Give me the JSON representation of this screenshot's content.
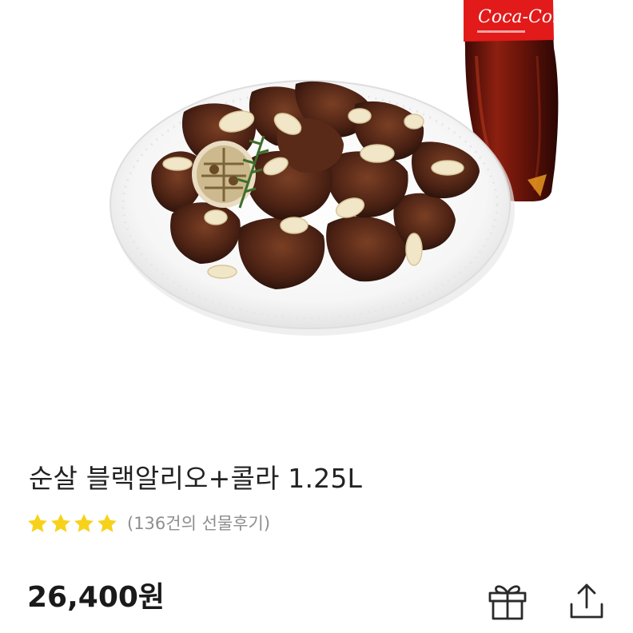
{
  "product": {
    "image_icon": "chicken-and-cola-photo",
    "bottle_label": "Coca-Cola",
    "title": "순살 블랙알리오+콜라 1.25L",
    "rating": {
      "stars": 4,
      "star_color": "#f8d21a",
      "review_text": "(136건의 선물후기)"
    },
    "price": "26,400원"
  },
  "actions": {
    "gift_icon": "gift-icon",
    "share_icon": "share-icon"
  }
}
